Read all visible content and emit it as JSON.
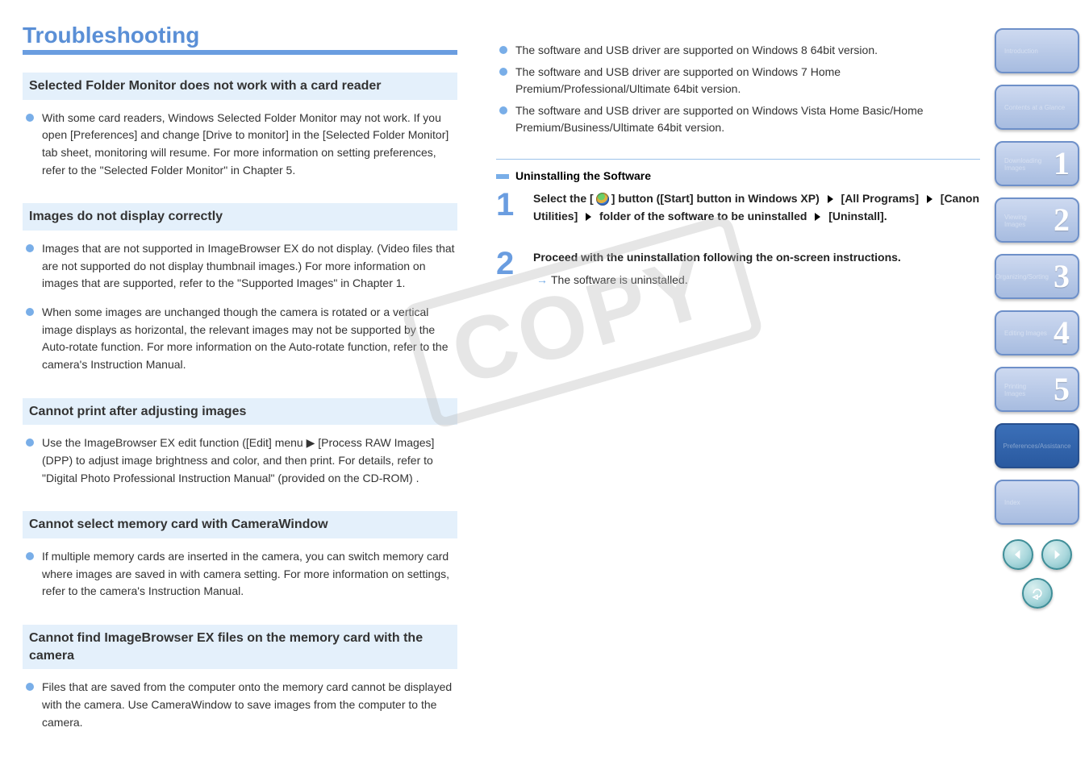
{
  "title": "Troubleshooting",
  "left": {
    "sections": [
      {
        "heading": "Selected Folder Monitor does not work with a card reader",
        "items": [
          "With some card readers, Windows Selected Folder Monitor may not work. If you open [Preferences] and change [Drive to monitor] in the [Selected Folder Monitor] tab sheet, monitoring will resume. For more information on setting preferences, refer to the \"Selected Folder Monitor\" in Chapter 5."
        ]
      },
      {
        "heading": "Images do not display correctly",
        "items": [
          "Images that are not supported in ImageBrowser EX do not display. (Video files that are not supported do not display thumbnail images.) For more information on images that are supported, refer to the \"Supported Images\" in Chapter 1.",
          "When some images are unchanged though the camera is rotated or a vertical image displays as horizontal, the relevant images may not be supported by the Auto-rotate function. For more information on the Auto-rotate function, refer to the camera's Instruction Manual."
        ]
      },
      {
        "heading": "Cannot print after adjusting images",
        "items": [
          "Use the ImageBrowser EX edit function ([Edit] menu ▶ [Process RAW Images] (DPP) to adjust image brightness and color, and then print. For details, refer to \"Digital Photo Professional Instruction Manual\" (provided on the CD-ROM) ."
        ]
      },
      {
        "heading": "Cannot select memory card with CameraWindow",
        "items": [
          "If multiple memory cards are inserted in the camera, you can switch memory card where images are saved in with camera setting. For more information on settings, refer to the camera's Instruction Manual."
        ]
      },
      {
        "heading": "Cannot find ImageBrowser EX files on the memory card with the camera",
        "items": [
          "Files that are saved from the computer onto the memory card cannot be displayed with the camera. Use CameraWindow to save images from the computer to the camera."
        ]
      }
    ]
  },
  "right": {
    "bullets": [
      "The software and USB driver are supported on Windows 8 64bit version.",
      "The software and USB driver are supported on Windows 7 Home Premium/Professional/Ultimate 64bit version.",
      "The software and USB driver are supported on Windows Vista Home Basic/Home Premium/Business/Ultimate 64bit version."
    ],
    "sectionHeading": "Uninstalling the Software",
    "step1_pre": "Select the [",
    "step1_post": "] button ([Start] button in Windows XP)",
    "step1_path_1": "[All Programs]",
    "step1_path_2": "[Canon Utilities]",
    "step1_path_3": "folder of the software to be uninstalled",
    "step1_path_4": "[Uninstall].",
    "step2_title": "Proceed with the uninstallation following the on-screen instructions.",
    "step2_note": "The software is uninstalled."
  },
  "sidebar": {
    "items": [
      {
        "num": "",
        "label": "Introduction"
      },
      {
        "num": "",
        "label": "Contents at a Glance"
      },
      {
        "num": "1",
        "label": "Downloading Images"
      },
      {
        "num": "2",
        "label": "Viewing Images"
      },
      {
        "num": "3",
        "label": "Organizing/Sorting"
      },
      {
        "num": "4",
        "label": "Editing Images"
      },
      {
        "num": "5",
        "label": "Printing Images"
      },
      {
        "num": "",
        "label": "Preferences/Assistance",
        "active": true
      },
      {
        "num": "",
        "label": "Index"
      }
    ]
  }
}
